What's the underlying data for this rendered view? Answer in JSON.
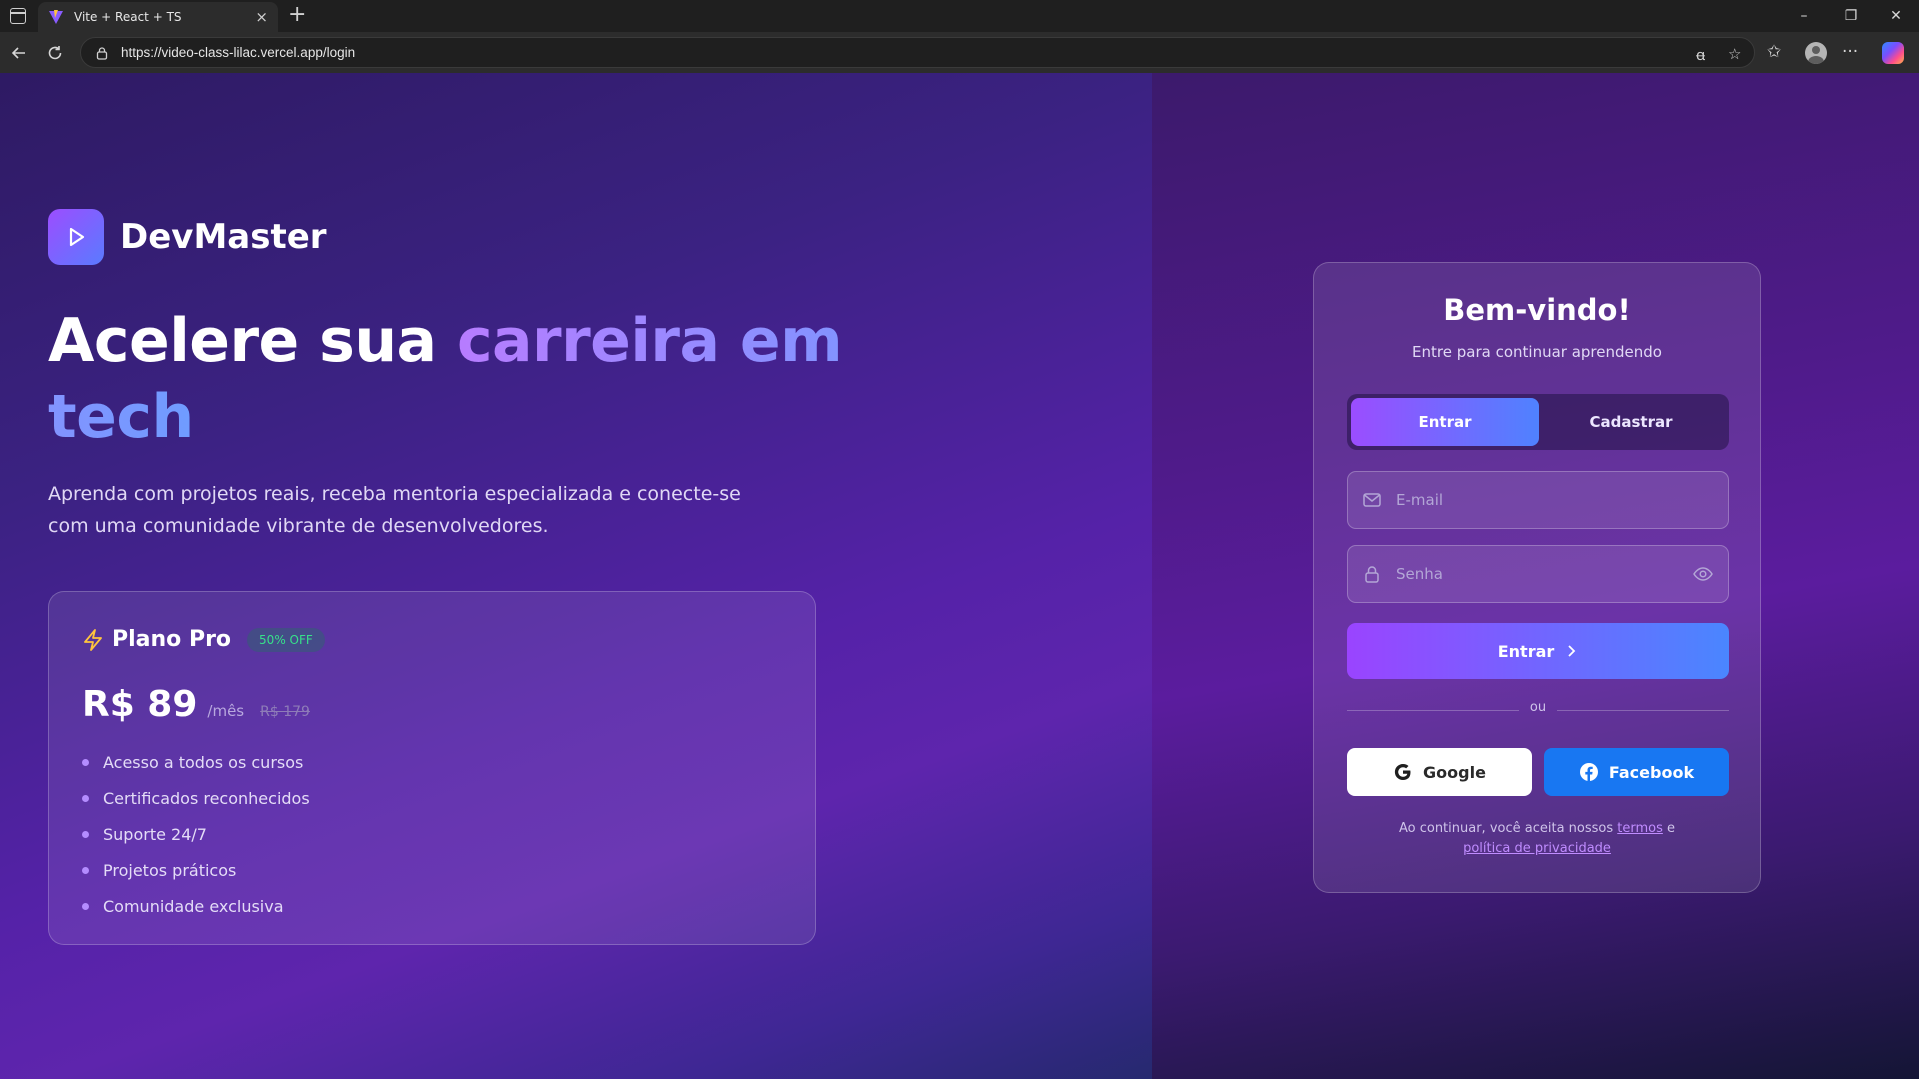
{
  "browser": {
    "tab_title": "Vite + React + TS",
    "url": "https://video-class-lilac.vercel.app/login"
  },
  "brand": {
    "name": "DevMaster"
  },
  "hero": {
    "headline_plain": "Acelere sua ",
    "headline_accent": "carreira em tech",
    "lead": "Aprenda com projetos reais, receba mentoria especializada e conecte-se com uma comunidade vibrante de desenvolvedores."
  },
  "plan": {
    "title": "Plano Pro",
    "badge": "50% OFF",
    "price": "R$ 89",
    "period": "/mês",
    "old_price": "R$ 179",
    "features": [
      "Acesso a todos os cursos",
      "Certificados reconhecidos",
      "Suporte 24/7",
      "Projetos práticos",
      "Comunidade exclusiva"
    ]
  },
  "login": {
    "title": "Bem-vindo!",
    "subtitle": "Entre para continuar aprendendo",
    "tabs": [
      "Entrar",
      "Cadastrar"
    ],
    "active_tab": "Entrar",
    "email_placeholder": "E-mail",
    "password_placeholder": "Senha",
    "submit_label": "Entrar",
    "divider": "ou",
    "google_label": "Google",
    "facebook_label": "Facebook",
    "terms_prefix": "Ao continuar, você aceita nossos ",
    "terms_link": "termos",
    "terms_mid": " e",
    "privacy_link": "política de privacidade"
  },
  "colors": {
    "accent_start": "#9b4dff",
    "accent_end": "#4f82ff",
    "badge_green": "#37e08a",
    "facebook_blue": "#1877f2"
  }
}
